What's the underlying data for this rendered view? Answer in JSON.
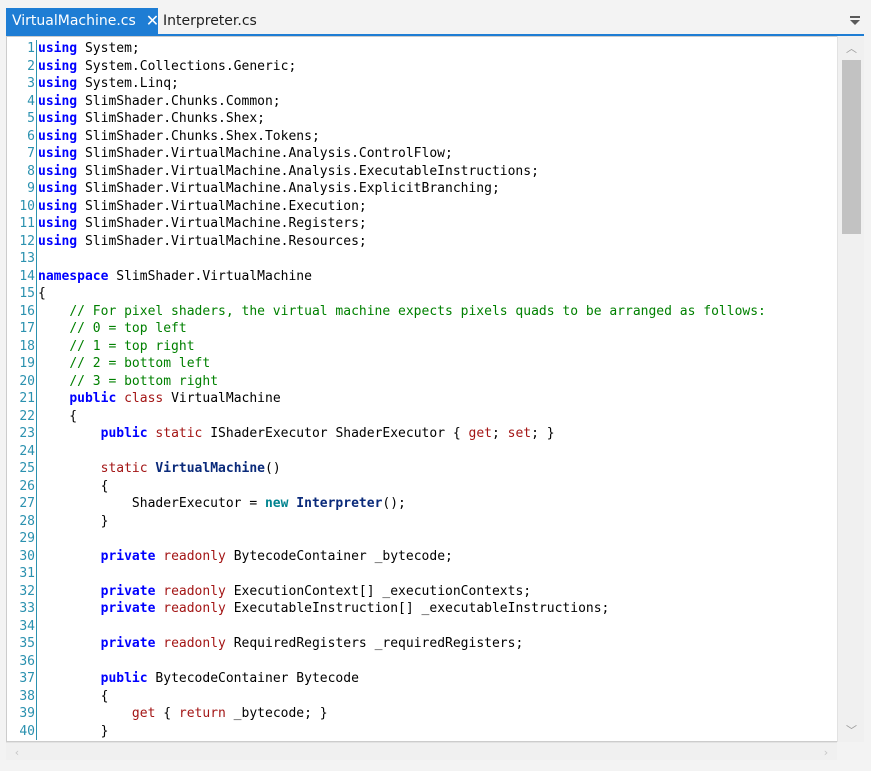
{
  "tabs": [
    {
      "label": "VirtualMachine.cs",
      "active": true
    },
    {
      "label": "Interpreter.cs",
      "active": false
    }
  ],
  "icons": {
    "close": "close-icon",
    "dropdown": "dropdown-icon",
    "scroll_up": "chevron-up-icon",
    "scroll_down": "chevron-down-icon",
    "scroll_left": "chevron-left-icon",
    "scroll_right": "chevron-right-icon"
  },
  "colors": {
    "tab_accent": "#1e7dd4",
    "keyword": "#0000ff",
    "comment": "#008000",
    "line_number": "#2b91af",
    "modifier": "#a31515"
  },
  "code_lines": [
    {
      "n": "1",
      "t": [
        [
          "kw",
          "using"
        ],
        [
          "tp",
          " System;"
        ]
      ]
    },
    {
      "n": "2",
      "t": [
        [
          "kw",
          "using"
        ],
        [
          "tp",
          " System.Collections.Generic;"
        ]
      ]
    },
    {
      "n": "3",
      "t": [
        [
          "kw",
          "using"
        ],
        [
          "tp",
          " System.Linq;"
        ]
      ]
    },
    {
      "n": "4",
      "t": [
        [
          "kw",
          "using"
        ],
        [
          "tp",
          " SlimShader.Chunks.Common;"
        ]
      ]
    },
    {
      "n": "5",
      "t": [
        [
          "kw",
          "using"
        ],
        [
          "tp",
          " SlimShader.Chunks.Shex;"
        ]
      ]
    },
    {
      "n": "6",
      "t": [
        [
          "kw",
          "using"
        ],
        [
          "tp",
          " SlimShader.Chunks.Shex.Tokens;"
        ]
      ]
    },
    {
      "n": "7",
      "t": [
        [
          "kw",
          "using"
        ],
        [
          "tp",
          " SlimShader.VirtualMachine.Analysis.ControlFlow;"
        ]
      ]
    },
    {
      "n": "8",
      "t": [
        [
          "kw",
          "using"
        ],
        [
          "tp",
          " SlimShader.VirtualMachine.Analysis.ExecutableInstructions;"
        ]
      ]
    },
    {
      "n": "9",
      "t": [
        [
          "kw",
          "using"
        ],
        [
          "tp",
          " SlimShader.VirtualMachine.Analysis.ExplicitBranching;"
        ]
      ]
    },
    {
      "n": "10",
      "t": [
        [
          "kw",
          "using"
        ],
        [
          "tp",
          " SlimShader.VirtualMachine.Execution;"
        ]
      ]
    },
    {
      "n": "11",
      "t": [
        [
          "kw",
          "using"
        ],
        [
          "tp",
          " SlimShader.VirtualMachine.Registers;"
        ]
      ]
    },
    {
      "n": "12",
      "t": [
        [
          "kw",
          "using"
        ],
        [
          "tp",
          " SlimShader.VirtualMachine.Resources;"
        ]
      ]
    },
    {
      "n": "13",
      "t": []
    },
    {
      "n": "14",
      "t": [
        [
          "kw",
          "namespace"
        ],
        [
          "tp",
          " SlimShader.VirtualMachine"
        ]
      ]
    },
    {
      "n": "15",
      "t": [
        [
          "tp",
          "{"
        ]
      ]
    },
    {
      "n": "16",
      "t": [
        [
          "tp",
          "    "
        ],
        [
          "cm",
          "// For pixel shaders, the virtual machine expects pixels quads to be arranged as follows:"
        ]
      ]
    },
    {
      "n": "17",
      "t": [
        [
          "tp",
          "    "
        ],
        [
          "cm",
          "// 0 = top left"
        ]
      ]
    },
    {
      "n": "18",
      "t": [
        [
          "tp",
          "    "
        ],
        [
          "cm",
          "// 1 = top right"
        ]
      ]
    },
    {
      "n": "19",
      "t": [
        [
          "tp",
          "    "
        ],
        [
          "cm",
          "// 2 = bottom left"
        ]
      ]
    },
    {
      "n": "20",
      "t": [
        [
          "tp",
          "    "
        ],
        [
          "cm",
          "// 3 = bottom right"
        ]
      ]
    },
    {
      "n": "21",
      "t": [
        [
          "tp",
          "    "
        ],
        [
          "kw",
          "public"
        ],
        [
          "tp",
          " "
        ],
        [
          "mod",
          "class"
        ],
        [
          "tp",
          " VirtualMachine"
        ]
      ]
    },
    {
      "n": "22",
      "t": [
        [
          "tp",
          "    {"
        ]
      ]
    },
    {
      "n": "23",
      "t": [
        [
          "tp",
          "        "
        ],
        [
          "kw",
          "public"
        ],
        [
          "tp",
          " "
        ],
        [
          "mod",
          "static"
        ],
        [
          "tp",
          " IShaderExecutor ShaderExecutor { "
        ],
        [
          "accessor",
          "get"
        ],
        [
          "tp",
          "; "
        ],
        [
          "accessor",
          "set"
        ],
        [
          "tp",
          "; }"
        ]
      ]
    },
    {
      "n": "24",
      "t": []
    },
    {
      "n": "25",
      "t": [
        [
          "tp",
          "        "
        ],
        [
          "mod",
          "static"
        ],
        [
          "tp",
          " "
        ],
        [
          "mt",
          "VirtualMachine"
        ],
        [
          "tp",
          "()"
        ]
      ]
    },
    {
      "n": "26",
      "t": [
        [
          "tp",
          "        {"
        ]
      ]
    },
    {
      "n": "27",
      "t": [
        [
          "tp",
          "            ShaderExecutor = "
        ],
        [
          "nw",
          "new"
        ],
        [
          "tp",
          " "
        ],
        [
          "mt",
          "Interpreter"
        ],
        [
          "tp",
          "();"
        ]
      ]
    },
    {
      "n": "28",
      "t": [
        [
          "tp",
          "        }"
        ]
      ]
    },
    {
      "n": "29",
      "t": []
    },
    {
      "n": "30",
      "t": [
        [
          "tp",
          "        "
        ],
        [
          "kw",
          "private"
        ],
        [
          "tp",
          " "
        ],
        [
          "mod",
          "readonly"
        ],
        [
          "tp",
          " BytecodeContainer _bytecode;"
        ]
      ]
    },
    {
      "n": "31",
      "t": []
    },
    {
      "n": "32",
      "t": [
        [
          "tp",
          "        "
        ],
        [
          "kw",
          "private"
        ],
        [
          "tp",
          " "
        ],
        [
          "mod",
          "readonly"
        ],
        [
          "tp",
          " ExecutionContext[] _executionContexts;"
        ]
      ]
    },
    {
      "n": "33",
      "t": [
        [
          "tp",
          "        "
        ],
        [
          "kw",
          "private"
        ],
        [
          "tp",
          " "
        ],
        [
          "mod",
          "readonly"
        ],
        [
          "tp",
          " ExecutableInstruction[] _executableInstructions;"
        ]
      ]
    },
    {
      "n": "34",
      "t": []
    },
    {
      "n": "35",
      "t": [
        [
          "tp",
          "        "
        ],
        [
          "kw",
          "private"
        ],
        [
          "tp",
          " "
        ],
        [
          "mod",
          "readonly"
        ],
        [
          "tp",
          " RequiredRegisters _requiredRegisters;"
        ]
      ]
    },
    {
      "n": "36",
      "t": []
    },
    {
      "n": "37",
      "t": [
        [
          "tp",
          "        "
        ],
        [
          "kw",
          "public"
        ],
        [
          "tp",
          " BytecodeContainer Bytecode"
        ]
      ]
    },
    {
      "n": "38",
      "t": [
        [
          "tp",
          "        {"
        ]
      ]
    },
    {
      "n": "39",
      "t": [
        [
          "tp",
          "            "
        ],
        [
          "accessor",
          "get"
        ],
        [
          "tp",
          " { "
        ],
        [
          "accessor",
          "return"
        ],
        [
          "tp",
          " _bytecode; }"
        ]
      ]
    },
    {
      "n": "40",
      "t": [
        [
          "tp",
          "        }"
        ]
      ]
    }
  ]
}
